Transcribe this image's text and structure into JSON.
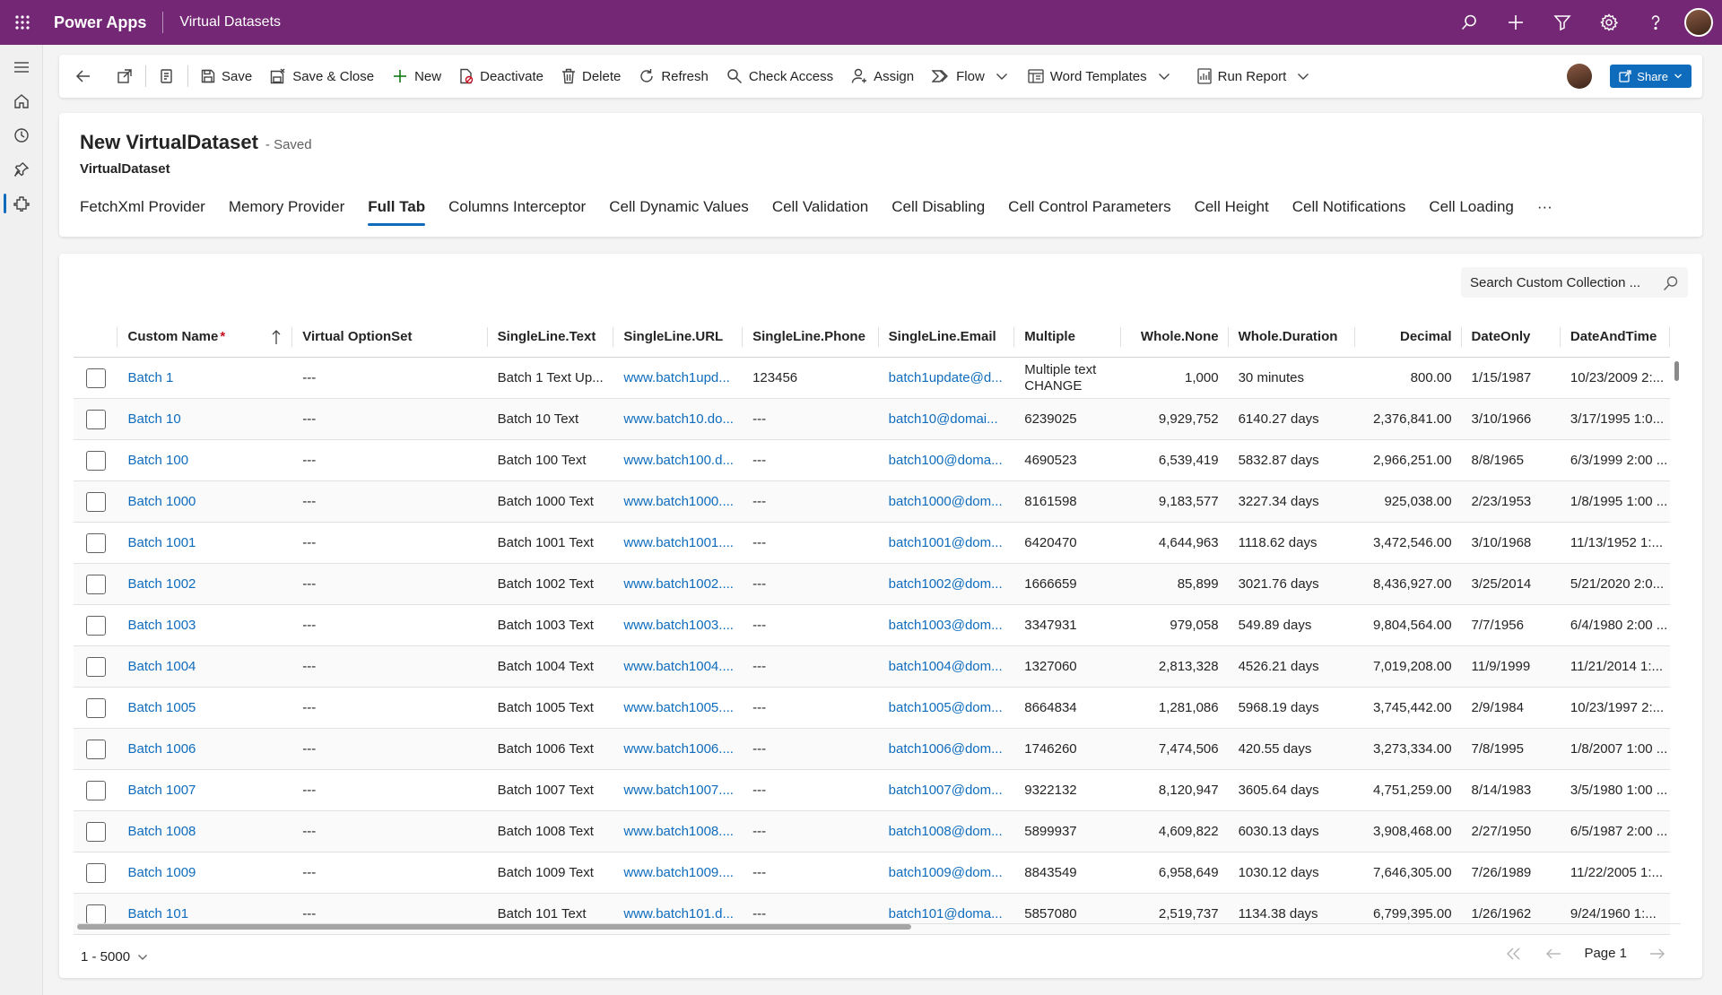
{
  "topbar": {
    "app_name": "Power Apps",
    "environment": "Virtual Datasets",
    "bg_color": "#742774",
    "icons": [
      "search-icon",
      "plus-icon",
      "filter-icon",
      "gear-icon",
      "help-icon"
    ]
  },
  "leftnav": {
    "icons": [
      "hamburger-icon",
      "home-icon",
      "recent-icon",
      "pin-icon",
      "entity-icon"
    ]
  },
  "commands": {
    "save": "Save",
    "save_close": "Save & Close",
    "new": "New",
    "deactivate": "Deactivate",
    "delete": "Delete",
    "refresh": "Refresh",
    "check_access": "Check Access",
    "assign": "Assign",
    "flow": "Flow",
    "word_templates": "Word Templates",
    "run_report": "Run Report",
    "share": "Share"
  },
  "record": {
    "title": "New VirtualDataset",
    "status": "- Saved",
    "entity": "VirtualDataset"
  },
  "tabs": [
    "FetchXml Provider",
    "Memory Provider",
    "Full Tab",
    "Columns Interceptor",
    "Cell Dynamic Values",
    "Cell Validation",
    "Cell Disabling",
    "Cell Control Parameters",
    "Cell Height",
    "Cell Notifications",
    "Cell Loading",
    "···"
  ],
  "active_tab": "Full Tab",
  "search": {
    "placeholder": "Search Custom Collection ..."
  },
  "grid": {
    "columns": [
      "Custom Name",
      "Virtual OptionSet",
      "SingleLine.Text",
      "SingleLine.URL",
      "SingleLine.Phone",
      "SingleLine.Email",
      "Multiple",
      "Whole.None",
      "Whole.Duration",
      "Decimal",
      "DateOnly",
      "DateAndTime"
    ],
    "required_marker": "*",
    "rows": [
      {
        "name": "Batch 1",
        "opt": "---",
        "text": "Batch 1 Text Up...",
        "url": "www.batch1upd...",
        "phone": "123456",
        "email": "batch1update@d...",
        "multiple": "Multiple text CHANGE",
        "whole": "1,000",
        "duration": "30 minutes",
        "decimal": "800.00",
        "date": "1/15/1987",
        "datetime": "10/23/2009 2:..."
      },
      {
        "name": "Batch 10",
        "opt": "---",
        "text": "Batch 10 Text",
        "url": "www.batch10.do...",
        "phone": "---",
        "email": "batch10@domai...",
        "multiple": "6239025",
        "whole": "9,929,752",
        "duration": "6140.27 days",
        "decimal": "2,376,841.00",
        "date": "3/10/1966",
        "datetime": "3/17/1995 1:0..."
      },
      {
        "name": "Batch 100",
        "opt": "---",
        "text": "Batch 100 Text",
        "url": "www.batch100.d...",
        "phone": "---",
        "email": "batch100@doma...",
        "multiple": "4690523",
        "whole": "6,539,419",
        "duration": "5832.87 days",
        "decimal": "2,966,251.00",
        "date": "8/8/1965",
        "datetime": "6/3/1999 2:00 ..."
      },
      {
        "name": "Batch 1000",
        "opt": "---",
        "text": "Batch 1000 Text",
        "url": "www.batch1000....",
        "phone": "---",
        "email": "batch1000@dom...",
        "multiple": "8161598",
        "whole": "9,183,577",
        "duration": "3227.34 days",
        "decimal": "925,038.00",
        "date": "2/23/1953",
        "datetime": "1/8/1995 1:00 ..."
      },
      {
        "name": "Batch 1001",
        "opt": "---",
        "text": "Batch 1001 Text",
        "url": "www.batch1001....",
        "phone": "---",
        "email": "batch1001@dom...",
        "multiple": "6420470",
        "whole": "4,644,963",
        "duration": "1118.62 days",
        "decimal": "3,472,546.00",
        "date": "3/10/1968",
        "datetime": "11/13/1952 1:..."
      },
      {
        "name": "Batch 1002",
        "opt": "---",
        "text": "Batch 1002 Text",
        "url": "www.batch1002....",
        "phone": "---",
        "email": "batch1002@dom...",
        "multiple": "1666659",
        "whole": "85,899",
        "duration": "3021.76 days",
        "decimal": "8,436,927.00",
        "date": "3/25/2014",
        "datetime": "5/21/2020 2:0..."
      },
      {
        "name": "Batch 1003",
        "opt": "---",
        "text": "Batch 1003 Text",
        "url": "www.batch1003....",
        "phone": "---",
        "email": "batch1003@dom...",
        "multiple": "3347931",
        "whole": "979,058",
        "duration": "549.89 days",
        "decimal": "9,804,564.00",
        "date": "7/7/1956",
        "datetime": "6/4/1980 2:00 ..."
      },
      {
        "name": "Batch 1004",
        "opt": "---",
        "text": "Batch 1004 Text",
        "url": "www.batch1004....",
        "phone": "---",
        "email": "batch1004@dom...",
        "multiple": "1327060",
        "whole": "2,813,328",
        "duration": "4526.21 days",
        "decimal": "7,019,208.00",
        "date": "11/9/1999",
        "datetime": "11/21/2014 1:..."
      },
      {
        "name": "Batch 1005",
        "opt": "---",
        "text": "Batch 1005 Text",
        "url": "www.batch1005....",
        "phone": "---",
        "email": "batch1005@dom...",
        "multiple": "8664834",
        "whole": "1,281,086",
        "duration": "5968.19 days",
        "decimal": "3,745,442.00",
        "date": "2/9/1984",
        "datetime": "10/23/1997 2:..."
      },
      {
        "name": "Batch 1006",
        "opt": "---",
        "text": "Batch 1006 Text",
        "url": "www.batch1006....",
        "phone": "---",
        "email": "batch1006@dom...",
        "multiple": "1746260",
        "whole": "7,474,506",
        "duration": "420.55 days",
        "decimal": "3,273,334.00",
        "date": "7/8/1995",
        "datetime": "1/8/2007 1:00 ..."
      },
      {
        "name": "Batch 1007",
        "opt": "---",
        "text": "Batch 1007 Text",
        "url": "www.batch1007....",
        "phone": "---",
        "email": "batch1007@dom...",
        "multiple": "9322132",
        "whole": "8,120,947",
        "duration": "3605.64 days",
        "decimal": "4,751,259.00",
        "date": "8/14/1983",
        "datetime": "3/5/1980 1:00 ..."
      },
      {
        "name": "Batch 1008",
        "opt": "---",
        "text": "Batch 1008 Text",
        "url": "www.batch1008....",
        "phone": "---",
        "email": "batch1008@dom...",
        "multiple": "5899937",
        "whole": "4,609,822",
        "duration": "6030.13 days",
        "decimal": "3,908,468.00",
        "date": "2/27/1950",
        "datetime": "6/5/1987 2:00 ..."
      },
      {
        "name": "Batch 1009",
        "opt": "---",
        "text": "Batch 1009 Text",
        "url": "www.batch1009....",
        "phone": "---",
        "email": "batch1009@dom...",
        "multiple": "8843549",
        "whole": "6,958,649",
        "duration": "1030.12 days",
        "decimal": "7,646,305.00",
        "date": "7/26/1989",
        "datetime": "11/22/2005 1:..."
      },
      {
        "name": "Batch 101",
        "opt": "---",
        "text": "Batch 101 Text",
        "url": "www.batch101.d...",
        "phone": "---",
        "email": "batch101@doma...",
        "multiple": "5857080",
        "whole": "2,519,737",
        "duration": "1134.38 days",
        "decimal": "6,799,395.00",
        "date": "1/26/1962",
        "datetime": "9/24/1960 1:..."
      }
    ]
  },
  "footer": {
    "record_range": "1 - 5000",
    "page_label": "Page 1"
  },
  "colors": {
    "link": "#0f6cbd",
    "accent": "#0f6cbd",
    "required": "#c50f1f"
  }
}
